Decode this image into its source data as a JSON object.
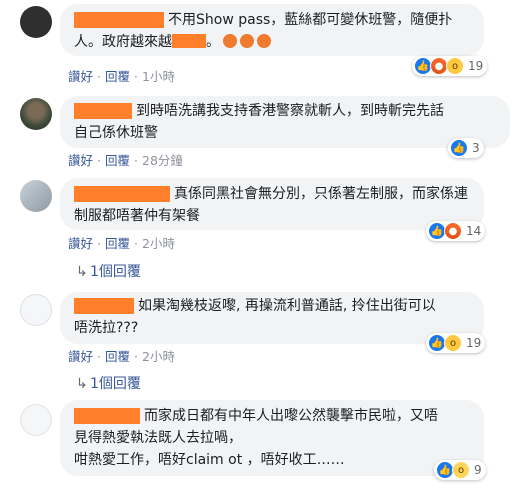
{
  "comments": [
    {
      "text_lines": [
        "不用Show pass，藍絲都可變休班警，隨便扑",
        "人。政府越來越"
      ],
      "actions": {
        "like": "讚好",
        "reply": "回覆",
        "time": "1小時"
      },
      "reactions": {
        "icons": [
          "like-icon",
          "angry-icon",
          "wow-icon"
        ],
        "count": "19"
      }
    },
    {
      "text_lines": [
        "到時唔洗講我支持香港警察就斬人，到時斬完先話",
        "自己係休班警"
      ],
      "actions": {
        "like": "讚好",
        "reply": "回覆",
        "time": "28分鐘"
      },
      "reactions": {
        "icons": [
          "like-icon"
        ],
        "count": "3"
      }
    },
    {
      "text_lines": [
        "真係同黑社會無分別，只係著左制服，而家係連",
        "制服都唔著仲有架餐"
      ],
      "actions": {
        "like": "讚好",
        "reply": "回覆",
        "time": "2小時"
      },
      "reactions": {
        "icons": [
          "like-icon",
          "angry-icon"
        ],
        "count": "14"
      },
      "replies": "1個回覆"
    },
    {
      "text_lines": [
        "如果淘幾枝返嚟, 再操流利普通話, 拎住出街可以",
        "唔洗拉???"
      ],
      "actions": {
        "like": "讚好",
        "reply": "回覆",
        "time": "2小時"
      },
      "reactions": {
        "icons": [
          "like-icon",
          "wow-icon"
        ],
        "count": "19"
      },
      "replies": "1個回覆"
    },
    {
      "text_lines": [
        "而家成日都有中年人出嚟公然襲擊市民啦，又唔",
        "見得熱愛執法既人去拉喎，",
        "咁熱愛工作，唔好claim ot ，唔好收工……"
      ],
      "actions": {},
      "reactions": {
        "icons": [
          "like-icon",
          "sad-icon"
        ],
        "count": "9"
      }
    }
  ],
  "colors": {
    "redaction": "#ff7f2a",
    "link": "#385898",
    "bubble": "#f2f3f5",
    "like": "#1877f2"
  }
}
